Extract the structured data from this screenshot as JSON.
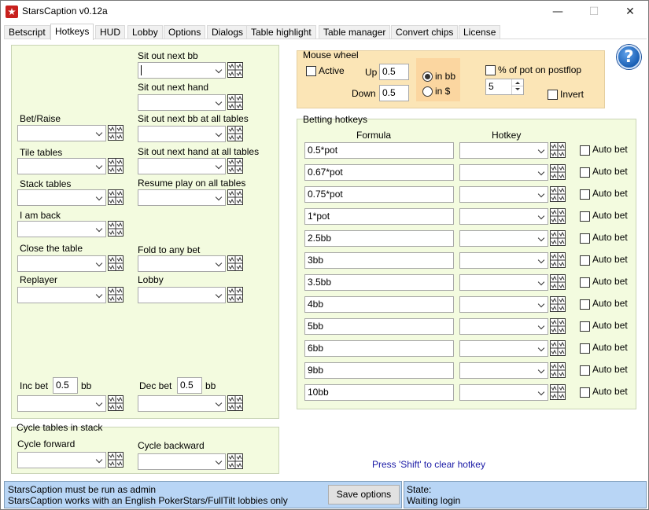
{
  "window": {
    "title": "StarsCaption v0.12a",
    "minimize_glyph": "—",
    "maximize_glyph": "☐",
    "close_glyph": "✕"
  },
  "tabs": [
    {
      "label": "Betscript"
    },
    {
      "label": "Hotkeys"
    },
    {
      "label": "HUD"
    },
    {
      "label": "Lobby"
    },
    {
      "label": "Options"
    },
    {
      "label": "Dialogs"
    },
    {
      "label": "Table highlight"
    },
    {
      "label": "Table manager"
    },
    {
      "label": "Convert chips"
    },
    {
      "label": "License"
    }
  ],
  "left_hotkeys": {
    "sit_out_next_bb": "Sit out next bb",
    "sit_out_next_hand": "Sit out next hand",
    "bet_raise": "Bet/Raise",
    "sit_out_next_bb_all": "Sit out next bb at all tables",
    "tile_tables": "Tile tables",
    "sit_out_next_hand_all": "Sit out next hand at all tables",
    "stack_tables": "Stack tables",
    "resume_play_all": "Resume play on all tables",
    "i_am_back": "I am back",
    "close_table": "Close the table",
    "fold_to_any_bet": "Fold to any bet",
    "replayer": "Replayer",
    "lobby": "Lobby",
    "inc_bet_label": "Inc bet",
    "inc_bet_value": "0.5",
    "inc_bet_unit": "bb",
    "dec_bet_label": "Dec bet",
    "dec_bet_value": "0.5",
    "dec_bet_unit": "bb"
  },
  "cycle": {
    "title": "Cycle tables in stack",
    "forward": "Cycle forward",
    "backward": "Cycle backward"
  },
  "mouse_wheel": {
    "title": "Mouse wheel",
    "active_label": "Active",
    "up_label": "Up",
    "up_value": "0.5",
    "down_label": "Down",
    "down_value": "0.5",
    "in_bb": "in bb",
    "in_dollar": "in $",
    "pct_pot_label": "% of pot on postflop",
    "pct_value": "5",
    "invert_label": "Invert"
  },
  "betting": {
    "title": "Betting hotkeys",
    "formula_header": "Formula",
    "hotkey_header": "Hotkey",
    "auto_bet_label": "Auto bet",
    "rows": [
      {
        "formula": "0.5*pot"
      },
      {
        "formula": "0.67*pot"
      },
      {
        "formula": "0.75*pot"
      },
      {
        "formula": "1*pot"
      },
      {
        "formula": "2.5bb"
      },
      {
        "formula": "3bb"
      },
      {
        "formula": "3.5bb"
      },
      {
        "formula": "4bb"
      },
      {
        "formula": "5bb"
      },
      {
        "formula": "6bb"
      },
      {
        "formula": "9bb"
      },
      {
        "formula": "10bb"
      }
    ]
  },
  "hint": "Press 'Shift' to clear hotkey",
  "status": {
    "line1": "StarsCaption must be run as admin",
    "line2": "StarsCaption works with an English PokerStars/FullTilt lobbies only",
    "save_button": "Save options",
    "state_label": "State:",
    "state_value": "Waiting login"
  },
  "help_glyph": "?",
  "colors": {
    "panel_green": "#f3fbdf",
    "mouse_wheel_orange": "#fbe5b6",
    "status_blue": "#b8d5f5",
    "hint_blue": "#1a1aa6"
  }
}
